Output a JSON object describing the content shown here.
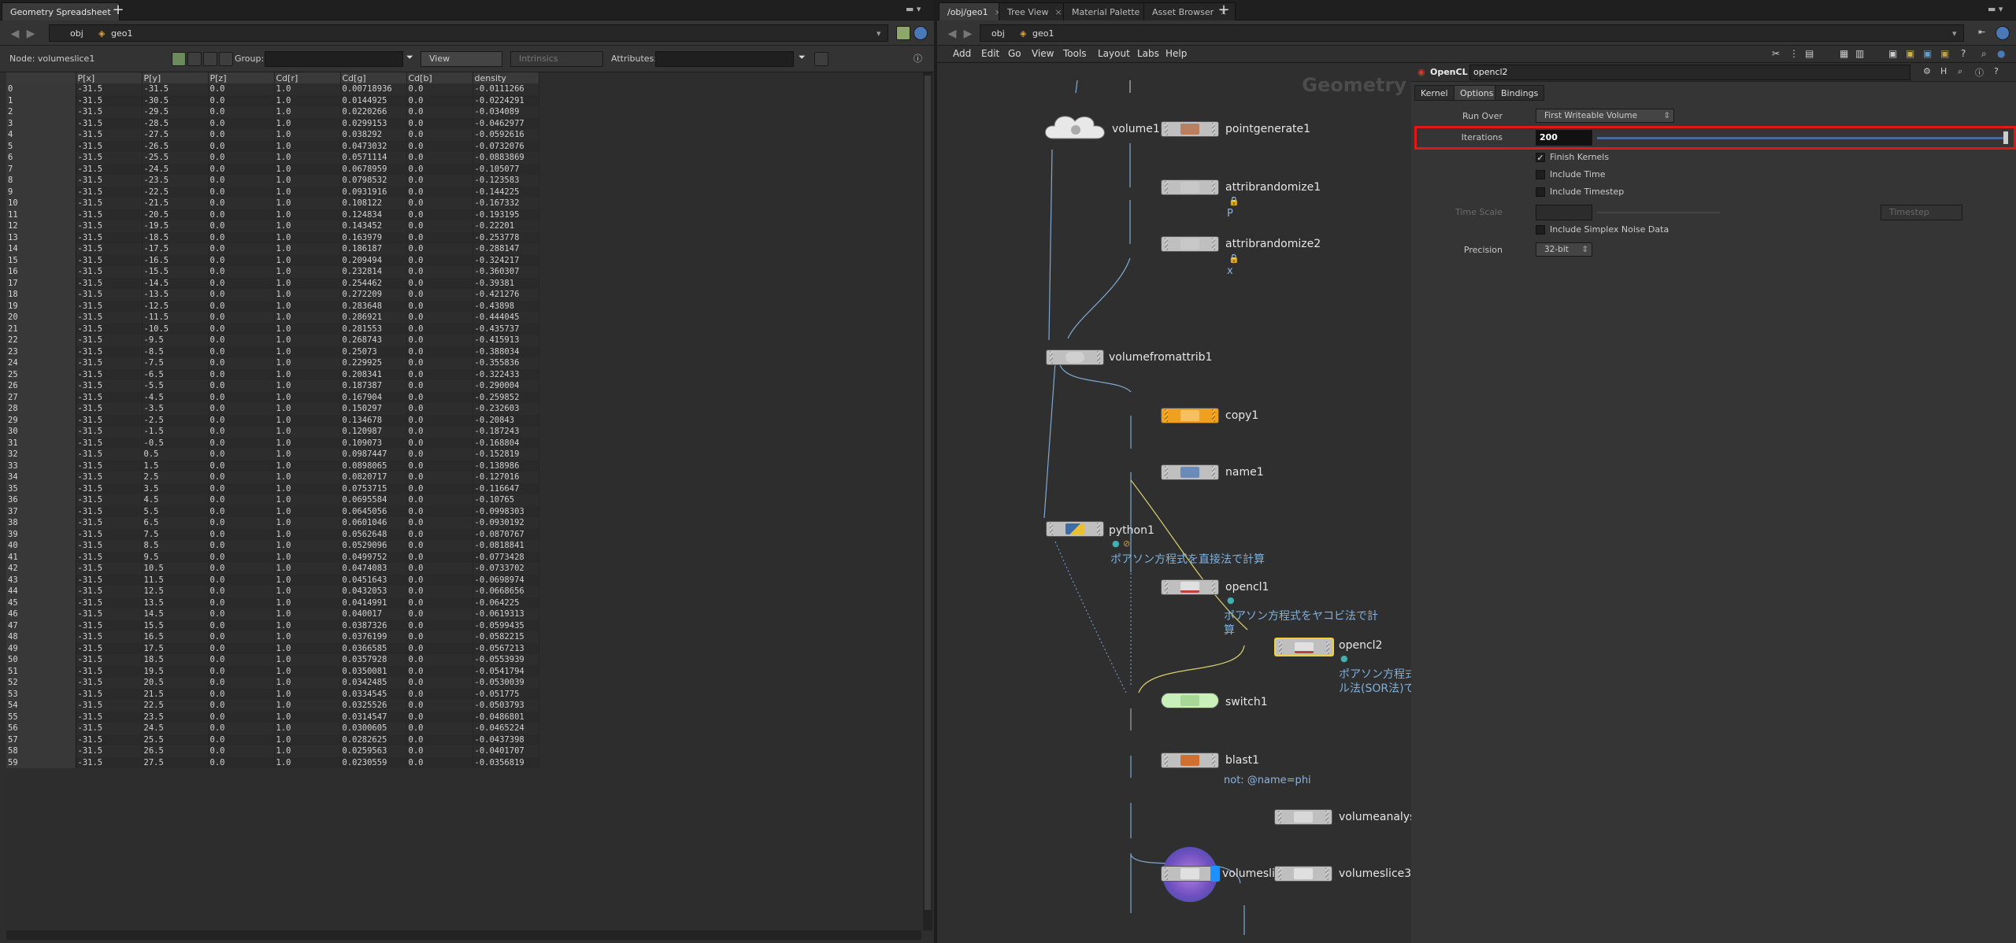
{
  "left_pane": {
    "tab": "Geometry Spreadsheet",
    "path": {
      "obj": "obj",
      "geo": "geo1"
    },
    "node_label": "Node: volumeslice1",
    "group_label": "Group:",
    "view_label": "View",
    "intrinsics_label": "Intrinsics",
    "attributes_label": "Attributes:",
    "columns": [
      "",
      "P[x]",
      "P[y]",
      "P[z]",
      "Cd[r]",
      "Cd[g]",
      "Cd[b]",
      "density"
    ],
    "rows": [
      [
        "0",
        "-31.5",
        "-31.5",
        "0.0",
        "1.0",
        "0.00718936",
        "0.0",
        "-0.0111266"
      ],
      [
        "1",
        "-31.5",
        "-30.5",
        "0.0",
        "1.0",
        "0.0144925",
        "0.0",
        "-0.0224291"
      ],
      [
        "2",
        "-31.5",
        "-29.5",
        "0.0",
        "1.0",
        "0.0220266",
        "0.0",
        "-0.034089"
      ],
      [
        "3",
        "-31.5",
        "-28.5",
        "0.0",
        "1.0",
        "0.0299153",
        "0.0",
        "-0.0462977"
      ],
      [
        "4",
        "-31.5",
        "-27.5",
        "0.0",
        "1.0",
        "0.038292",
        "0.0",
        "-0.0592616"
      ],
      [
        "5",
        "-31.5",
        "-26.5",
        "0.0",
        "1.0",
        "0.0473032",
        "0.0",
        "-0.0732076"
      ],
      [
        "6",
        "-31.5",
        "-25.5",
        "0.0",
        "1.0",
        "0.0571114",
        "0.0",
        "-0.0883869"
      ],
      [
        "7",
        "-31.5",
        "-24.5",
        "0.0",
        "1.0",
        "0.0678959",
        "0.0",
        "-0.105077"
      ],
      [
        "8",
        "-31.5",
        "-23.5",
        "0.0",
        "1.0",
        "0.0798532",
        "0.0",
        "-0.123583"
      ],
      [
        "9",
        "-31.5",
        "-22.5",
        "0.0",
        "1.0",
        "0.0931916",
        "0.0",
        "-0.144225"
      ],
      [
        "10",
        "-31.5",
        "-21.5",
        "0.0",
        "1.0",
        "0.108122",
        "0.0",
        "-0.167332"
      ],
      [
        "11",
        "-31.5",
        "-20.5",
        "0.0",
        "1.0",
        "0.124834",
        "0.0",
        "-0.193195"
      ],
      [
        "12",
        "-31.5",
        "-19.5",
        "0.0",
        "1.0",
        "0.143452",
        "0.0",
        "-0.22201"
      ],
      [
        "13",
        "-31.5",
        "-18.5",
        "0.0",
        "1.0",
        "0.163979",
        "0.0",
        "-0.253778"
      ],
      [
        "14",
        "-31.5",
        "-17.5",
        "0.0",
        "1.0",
        "0.186187",
        "0.0",
        "-0.288147"
      ],
      [
        "15",
        "-31.5",
        "-16.5",
        "0.0",
        "1.0",
        "0.209494",
        "0.0",
        "-0.324217"
      ],
      [
        "16",
        "-31.5",
        "-15.5",
        "0.0",
        "1.0",
        "0.232814",
        "0.0",
        "-0.360307"
      ],
      [
        "17",
        "-31.5",
        "-14.5",
        "0.0",
        "1.0",
        "0.254462",
        "0.0",
        "-0.39381"
      ],
      [
        "18",
        "-31.5",
        "-13.5",
        "0.0",
        "1.0",
        "0.272209",
        "0.0",
        "-0.421276"
      ],
      [
        "19",
        "-31.5",
        "-12.5",
        "0.0",
        "1.0",
        "0.283648",
        "0.0",
        "-0.43898"
      ],
      [
        "20",
        "-31.5",
        "-11.5",
        "0.0",
        "1.0",
        "0.286921",
        "0.0",
        "-0.444045"
      ],
      [
        "21",
        "-31.5",
        "-10.5",
        "0.0",
        "1.0",
        "0.281553",
        "0.0",
        "-0.435737"
      ],
      [
        "22",
        "-31.5",
        "-9.5",
        "0.0",
        "1.0",
        "0.268743",
        "0.0",
        "-0.415913"
      ],
      [
        "23",
        "-31.5",
        "-8.5",
        "0.0",
        "1.0",
        "0.25073",
        "0.0",
        "-0.388034"
      ],
      [
        "24",
        "-31.5",
        "-7.5",
        "0.0",
        "1.0",
        "0.229925",
        "0.0",
        "-0.355836"
      ],
      [
        "25",
        "-31.5",
        "-6.5",
        "0.0",
        "1.0",
        "0.208341",
        "0.0",
        "-0.322433"
      ],
      [
        "26",
        "-31.5",
        "-5.5",
        "0.0",
        "1.0",
        "0.187387",
        "0.0",
        "-0.290004"
      ],
      [
        "27",
        "-31.5",
        "-4.5",
        "0.0",
        "1.0",
        "0.167904",
        "0.0",
        "-0.259852"
      ],
      [
        "28",
        "-31.5",
        "-3.5",
        "0.0",
        "1.0",
        "0.150297",
        "0.0",
        "-0.232603"
      ],
      [
        "29",
        "-31.5",
        "-2.5",
        "0.0",
        "1.0",
        "0.134678",
        "0.0",
        "-0.20843"
      ],
      [
        "30",
        "-31.5",
        "-1.5",
        "0.0",
        "1.0",
        "0.120987",
        "0.0",
        "-0.187243"
      ],
      [
        "31",
        "-31.5",
        "-0.5",
        "0.0",
        "1.0",
        "0.109073",
        "0.0",
        "-0.168804"
      ],
      [
        "32",
        "-31.5",
        "0.5",
        "0.0",
        "1.0",
        "0.0987447",
        "0.0",
        "-0.152819"
      ],
      [
        "33",
        "-31.5",
        "1.5",
        "0.0",
        "1.0",
        "0.0898065",
        "0.0",
        "-0.138986"
      ],
      [
        "34",
        "-31.5",
        "2.5",
        "0.0",
        "1.0",
        "0.0820717",
        "0.0",
        "-0.127016"
      ],
      [
        "35",
        "-31.5",
        "3.5",
        "0.0",
        "1.0",
        "0.0753715",
        "0.0",
        "-0.116647"
      ],
      [
        "36",
        "-31.5",
        "4.5",
        "0.0",
        "1.0",
        "0.0695584",
        "0.0",
        "-0.10765"
      ],
      [
        "37",
        "-31.5",
        "5.5",
        "0.0",
        "1.0",
        "0.0645056",
        "0.0",
        "-0.0998303"
      ],
      [
        "38",
        "-31.5",
        "6.5",
        "0.0",
        "1.0",
        "0.0601046",
        "0.0",
        "-0.0930192"
      ],
      [
        "39",
        "-31.5",
        "7.5",
        "0.0",
        "1.0",
        "0.0562648",
        "0.0",
        "-0.0870767"
      ],
      [
        "40",
        "-31.5",
        "8.5",
        "0.0",
        "1.0",
        "0.0529096",
        "0.0",
        "-0.0818841"
      ],
      [
        "41",
        "-31.5",
        "9.5",
        "0.0",
        "1.0",
        "0.0499752",
        "0.0",
        "-0.0773428"
      ],
      [
        "42",
        "-31.5",
        "10.5",
        "0.0",
        "1.0",
        "0.0474083",
        "0.0",
        "-0.0733702"
      ],
      [
        "43",
        "-31.5",
        "11.5",
        "0.0",
        "1.0",
        "0.0451643",
        "0.0",
        "-0.0698974"
      ],
      [
        "44",
        "-31.5",
        "12.5",
        "0.0",
        "1.0",
        "0.0432053",
        "0.0",
        "-0.0668656"
      ],
      [
        "45",
        "-31.5",
        "13.5",
        "0.0",
        "1.0",
        "0.0414991",
        "0.0",
        "-0.064225"
      ],
      [
        "46",
        "-31.5",
        "14.5",
        "0.0",
        "1.0",
        "0.040017",
        "0.0",
        "-0.0619313"
      ],
      [
        "47",
        "-31.5",
        "15.5",
        "0.0",
        "1.0",
        "0.0387326",
        "0.0",
        "-0.0599435"
      ],
      [
        "48",
        "-31.5",
        "16.5",
        "0.0",
        "1.0",
        "0.0376199",
        "0.0",
        "-0.0582215"
      ],
      [
        "49",
        "-31.5",
        "17.5",
        "0.0",
        "1.0",
        "0.0366585",
        "0.0",
        "-0.0567213"
      ],
      [
        "50",
        "-31.5",
        "18.5",
        "0.0",
        "1.0",
        "0.0357928",
        "0.0",
        "-0.0553939"
      ],
      [
        "51",
        "-31.5",
        "19.5",
        "0.0",
        "1.0",
        "0.0350081",
        "0.0",
        "-0.0541794"
      ],
      [
        "52",
        "-31.5",
        "20.5",
        "0.0",
        "1.0",
        "0.0342485",
        "0.0",
        "-0.0530039"
      ],
      [
        "53",
        "-31.5",
        "21.5",
        "0.0",
        "1.0",
        "0.0334545",
        "0.0",
        "-0.051775"
      ],
      [
        "54",
        "-31.5",
        "22.5",
        "0.0",
        "1.0",
        "0.0325526",
        "0.0",
        "-0.0503793"
      ],
      [
        "55",
        "-31.5",
        "23.5",
        "0.0",
        "1.0",
        "0.0314547",
        "0.0",
        "-0.0486801"
      ],
      [
        "56",
        "-31.5",
        "24.5",
        "0.0",
        "1.0",
        "0.0300605",
        "0.0",
        "-0.0465224"
      ],
      [
        "57",
        "-31.5",
        "25.5",
        "0.0",
        "1.0",
        "0.0282625",
        "0.0",
        "-0.0437398"
      ],
      [
        "58",
        "-31.5",
        "26.5",
        "0.0",
        "1.0",
        "0.0259563",
        "0.0",
        "-0.0401707"
      ],
      [
        "59",
        "-31.5",
        "27.5",
        "0.0",
        "1.0",
        "0.0230559",
        "0.0",
        "-0.0356819"
      ]
    ]
  },
  "right_pane": {
    "tabs": [
      "/obj/geo1",
      "Tree View",
      "Material Palette",
      "Asset Browser"
    ],
    "path": {
      "obj": "obj",
      "geo": "geo1"
    },
    "menu": [
      "Add",
      "Edit",
      "Go",
      "View",
      "Tools",
      "Layout",
      "Labs",
      "Help"
    ],
    "network_label": "Geometry",
    "nodes": {
      "volume1": "volume1",
      "pointgenerate1": "pointgenerate1",
      "attribrandomize1": "attribrandomize1",
      "attribrandomize1_sub": "P",
      "attribrandomize2": "attribrandomize2",
      "attribrandomize2_sub": "x",
      "volumefromattrib1": "volumefromattrib1",
      "copy1": "copy1",
      "name1": "name1",
      "python1": "python1",
      "python1_comment": "ポアソン方程式を直接法で計算",
      "opencl1": "opencl1",
      "opencl1_comment_1": "ポアソン方程式をヤコビ法で計",
      "opencl1_comment_2": "算",
      "opencl2": "opencl2",
      "opencl2_comment_1": "ポアソン方程式",
      "opencl2_comment_2": "ル法(SOR法)で",
      "switch1": "switch1",
      "blast1": "blast1",
      "blast1_sub": "not: @name=phi",
      "volumeanalysis": "volumeanalys",
      "volumeslice1": "volumesli",
      "volumeslice3": "volumeslice3"
    },
    "params": {
      "node_type": "OpenCL",
      "node_name": "opencl2",
      "tabs": [
        "Kernel",
        "Options",
        "Bindings"
      ],
      "run_over_label": "Run Over",
      "run_over_value": "First Writeable Volume",
      "iterations_label": "Iterations",
      "iterations_value": "200",
      "finish_kernels": "Finish Kernels",
      "include_time": "Include Time",
      "include_timestep": "Include Timestep",
      "time_scale_label": "Time Scale",
      "timestep_label": "Timestep",
      "include_simplex": "Include Simplex Noise Data",
      "precision_label": "Precision",
      "precision_value": "32-bit"
    },
    "highlight_color": "#e01818"
  }
}
